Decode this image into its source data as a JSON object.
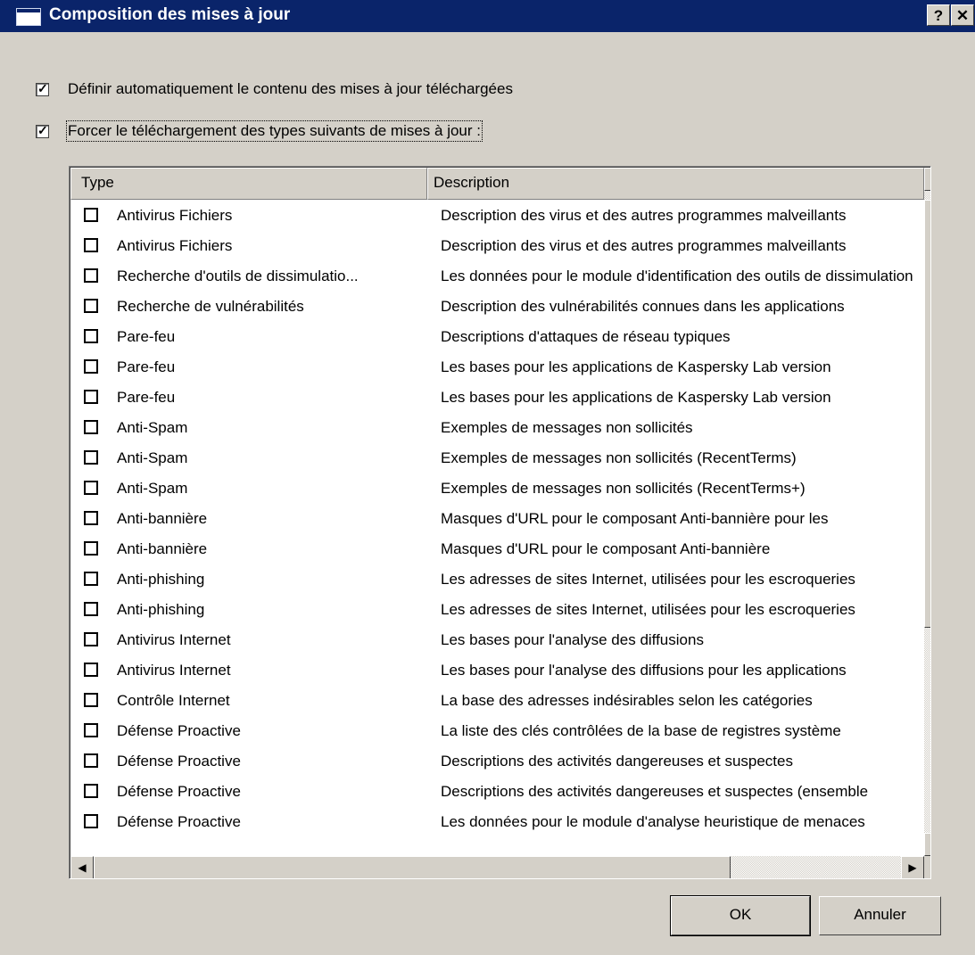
{
  "window": {
    "title": "Composition des mises à jour",
    "help_label": "?",
    "close_label": "✕"
  },
  "options": {
    "auto_define": {
      "label": "Définir automatiquement le contenu des mises à jour téléchargées",
      "checked": true
    },
    "force_download": {
      "label": "Forcer le téléchargement des types suivants de mises à jour :",
      "checked": true
    }
  },
  "table": {
    "columns": [
      "Type",
      "Description"
    ],
    "rows": [
      {
        "type": "Antivirus Fichiers",
        "description": "Description des virus et des autres programmes malveillants"
      },
      {
        "type": "Antivirus Fichiers",
        "description": "Description des virus et des autres programmes malveillants"
      },
      {
        "type": "Recherche d'outils de dissimulatio...",
        "description": "Les données pour le module d'identification des outils de dissimulation"
      },
      {
        "type": "Recherche de vulnérabilités",
        "description": "Description des vulnérabilités connues dans les applications"
      },
      {
        "type": "Pare-feu",
        "description": "Descriptions d'attaques de réseau typiques"
      },
      {
        "type": "Pare-feu",
        "description": "Les bases pour les applications de Kaspersky Lab version"
      },
      {
        "type": "Pare-feu",
        "description": "Les bases pour les applications de Kaspersky Lab version"
      },
      {
        "type": "Anti-Spam",
        "description": "Exemples de messages non sollicités"
      },
      {
        "type": "Anti-Spam",
        "description": "Exemples de messages non sollicités (RecentTerms)"
      },
      {
        "type": "Anti-Spam",
        "description": "Exemples de messages non sollicités (RecentTerms+)"
      },
      {
        "type": "Anti-bannière",
        "description": "Masques d'URL pour le composant Anti-bannière pour les"
      },
      {
        "type": "Anti-bannière",
        "description": "Masques d'URL pour le composant Anti-bannière"
      },
      {
        "type": "Anti-phishing",
        "description": "Les adresses de sites Internet, utilisées pour les escroqueries"
      },
      {
        "type": "Anti-phishing",
        "description": "Les adresses de sites Internet, utilisées pour les escroqueries"
      },
      {
        "type": "Antivirus Internet",
        "description": "Les bases pour l'analyse des diffusions"
      },
      {
        "type": "Antivirus Internet",
        "description": "Les bases pour l'analyse des diffusions pour les applications"
      },
      {
        "type": "Contrôle Internet",
        "description": " La base des adresses indésirables selon les catégories"
      },
      {
        "type": "Défense Proactive",
        "description": "La liste des clés contrôlées de la base de registres système"
      },
      {
        "type": "Défense Proactive",
        "description": "Descriptions des activités dangereuses et suspectes"
      },
      {
        "type": "Défense Proactive",
        "description": "Descriptions des activités dangereuses et suspectes (ensemble"
      },
      {
        "type": "Défense Proactive",
        "description": "Les données pour le module d'analyse heuristique de menaces"
      }
    ]
  },
  "scrollbar_icons": {
    "up": "▲",
    "down": "▼",
    "left": "◀",
    "right": "▶"
  },
  "buttons": {
    "ok": "OK",
    "cancel": "Annuler"
  }
}
